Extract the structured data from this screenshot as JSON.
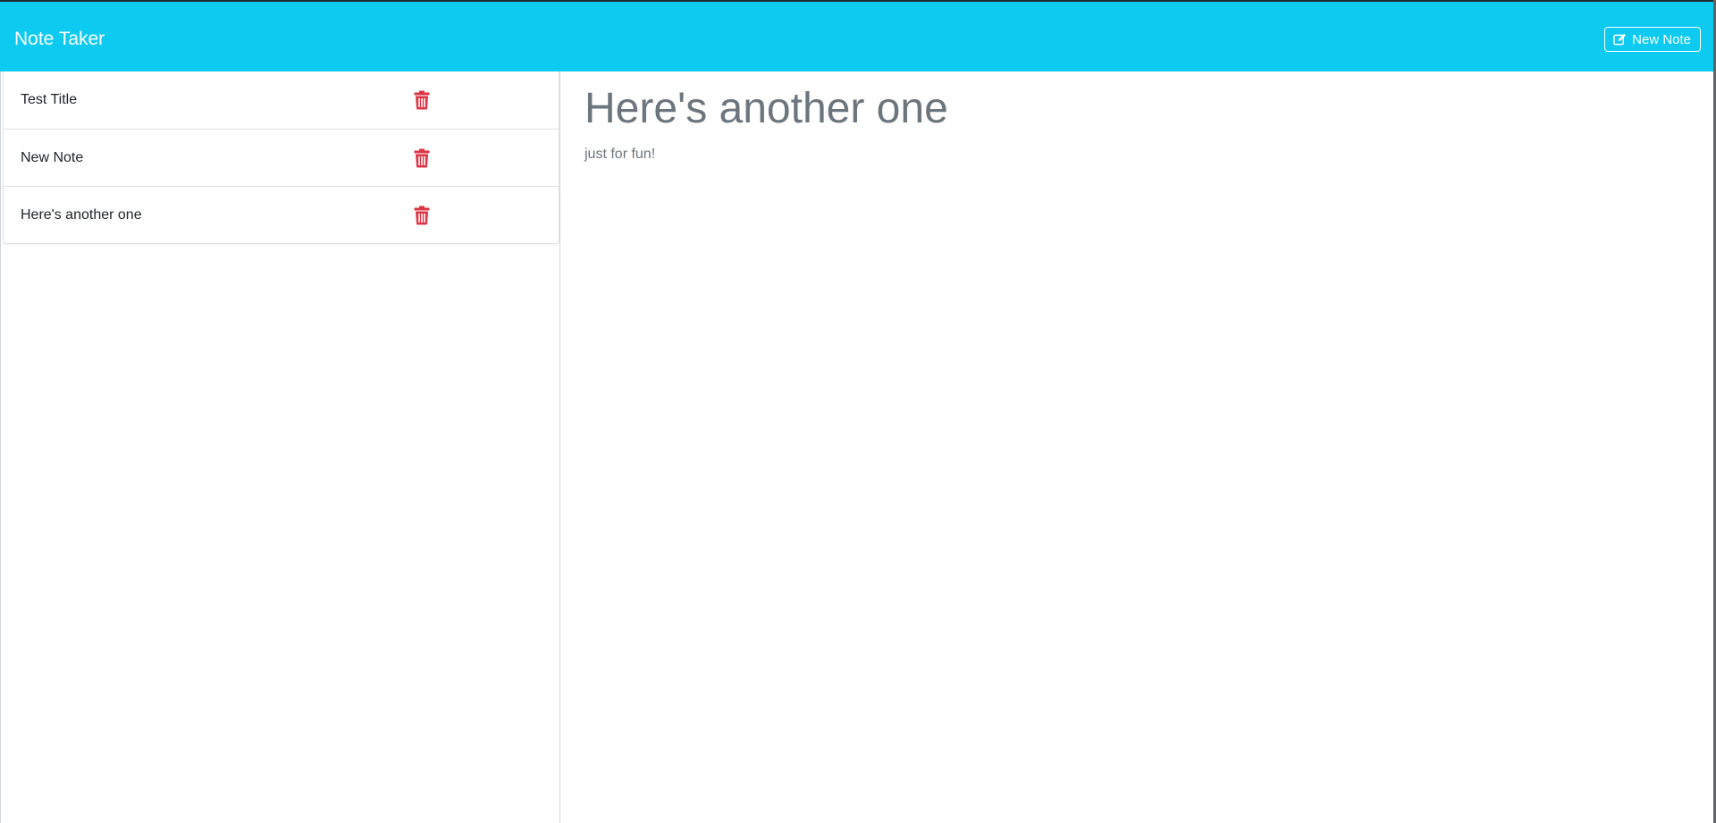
{
  "app": {
    "brand": "Note Taker",
    "new_note_label": "New Note",
    "new_note_icon": "edit-icon",
    "delete_icon": "trash-icon"
  },
  "colors": {
    "navbar": "#0dcaf0",
    "delete": "#dc3545",
    "muted_text": "#6c757d"
  },
  "notes": [
    {
      "title": "Test Title"
    },
    {
      "title": "New Note"
    },
    {
      "title": "Here's another one"
    }
  ],
  "active_note": {
    "title": "Here's another one",
    "text": "just for fun!"
  }
}
